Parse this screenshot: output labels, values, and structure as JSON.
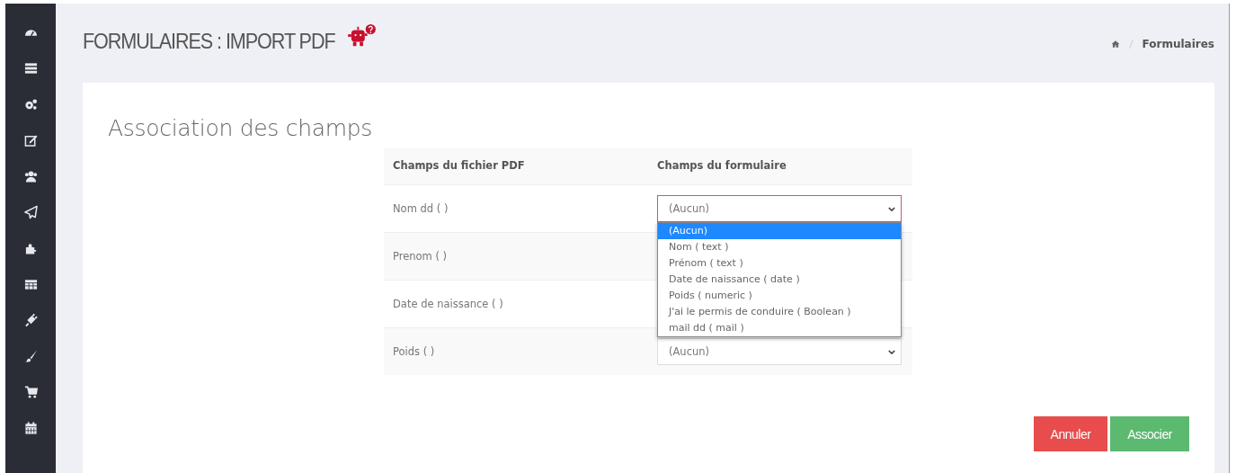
{
  "header": {
    "title": "FORMULAIRES : IMPORT PDF",
    "breadcrumb": [
      "Formulaires"
    ]
  },
  "card": {
    "heading": "Association des champs"
  },
  "table": {
    "columns": [
      "Champs du fichier PDF",
      "Champs du formulaire"
    ],
    "rows": [
      {
        "pdf_field": "Nom dd ( )",
        "form_field": "(Aucun)",
        "open": true
      },
      {
        "pdf_field": "Prenom ( )"
      },
      {
        "pdf_field": "Date de naissance ( )"
      },
      {
        "pdf_field": "Poids ( )",
        "form_field": "(Aucun)",
        "open": false
      }
    ]
  },
  "dropdown": {
    "options": [
      {
        "label": "(Aucun)",
        "selected": true
      },
      {
        "label": "Nom ( text )",
        "selected": false
      },
      {
        "label": "Prénom ( text )",
        "selected": false
      },
      {
        "label": "Date de naissance ( date )",
        "selected": false
      },
      {
        "label": "Poids ( numeric )",
        "selected": false
      },
      {
        "label": "J'ai le permis de conduire ( Boolean )",
        "selected": false
      },
      {
        "label": "mail dd ( mail )",
        "selected": false
      }
    ]
  },
  "buttons": [
    {
      "label": "Annuler",
      "kind": "cancel"
    },
    {
      "label": "Associer",
      "kind": "confirm"
    }
  ]
}
